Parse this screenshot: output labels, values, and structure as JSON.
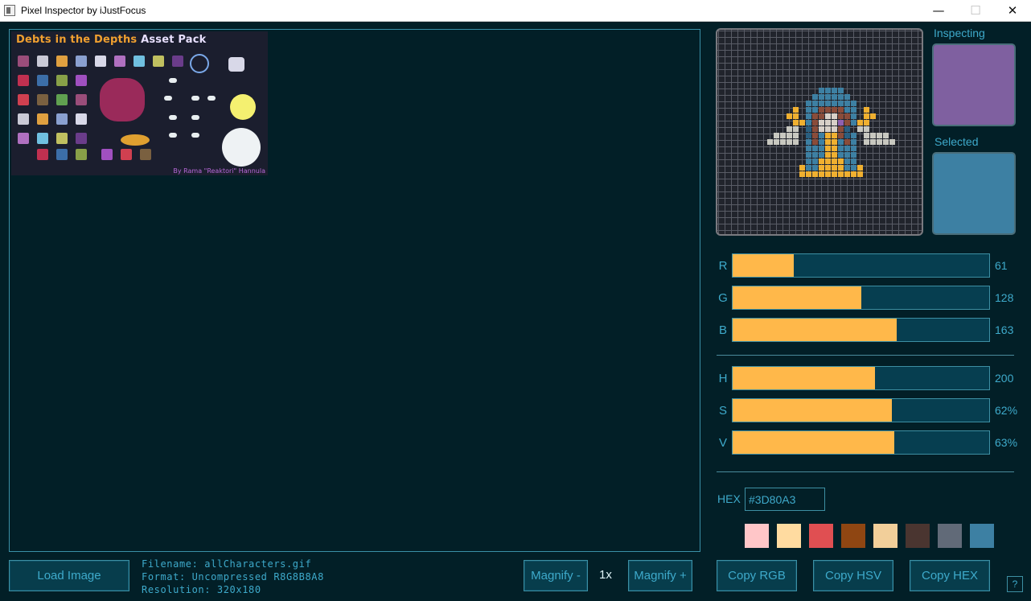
{
  "window": {
    "title": "Pixel Inspector by iJustFocus",
    "min": "—",
    "max": "☐",
    "close": "✕"
  },
  "sheet": {
    "title_a": "Debts in the Depths",
    "title_b": "Asset Pack",
    "credit": "By Rama \"Reaktori\" Hannula"
  },
  "swatches": {
    "inspecting_label": "Inspecting",
    "inspecting_color": "#7f60a0",
    "selected_label": "Selected",
    "selected_color": "#3d80a3"
  },
  "channels": [
    {
      "key": "R",
      "value": "61",
      "fraction": 0.239
    },
    {
      "key": "G",
      "value": "128",
      "fraction": 0.502
    },
    {
      "key": "B",
      "value": "163",
      "fraction": 0.639
    },
    {
      "key": "H",
      "value": "200",
      "fraction": 0.556
    },
    {
      "key": "S",
      "value": "62%",
      "fraction": 0.62
    },
    {
      "key": "V",
      "value": "63%",
      "fraction": 0.63
    }
  ],
  "hex": {
    "label": "HEX",
    "value": "#3D80A3"
  },
  "palette": [
    "#ffc6c8",
    "#ffdba0",
    "#e04f52",
    "#8f4612",
    "#f2cf9a",
    "#4a3530",
    "#616a78",
    "#3d80a3"
  ],
  "buttons": {
    "load": "Load Image",
    "magnify_minus": "Magnify -",
    "magnify_plus": "Magnify +",
    "copy_rgb": "Copy RGB",
    "copy_hsv": "Copy HSV",
    "copy_hex": "Copy HEX",
    "help": "?"
  },
  "file_info": {
    "filename": "Filename: allCharacters.gif",
    "format": "Format: Uncompressed R8G8B8A8",
    "resolution": "Resolution: 320x180"
  },
  "zoom": "1x",
  "colors": {
    "accent": "#3eaacb",
    "bar_fill": "#ffb84a",
    "background": "#021f27"
  }
}
